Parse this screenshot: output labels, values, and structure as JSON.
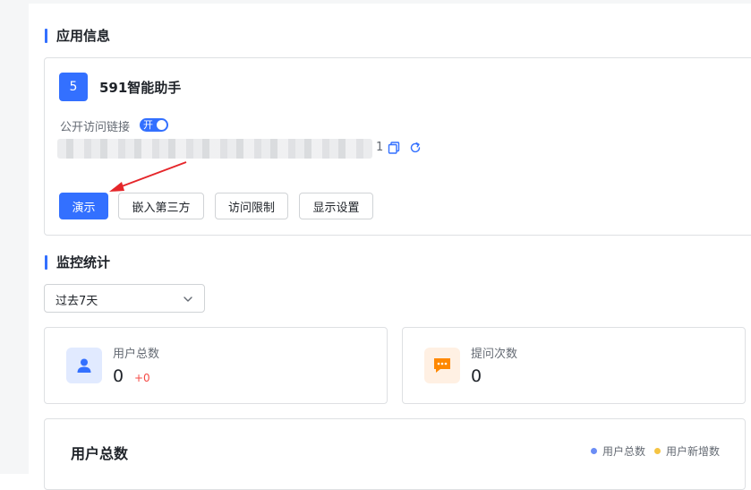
{
  "app_info": {
    "section_title": "应用信息",
    "avatar_letter": "5",
    "name": "591智能助手",
    "public_link_label": "公开访问链接",
    "switch_label": "开",
    "link_suffix": "1",
    "buttons": {
      "demo": "演示",
      "embed": "嵌入第三方",
      "access_limit": "访问限制",
      "display_settings": "显示设置"
    },
    "accent_color": "#3370ff"
  },
  "monitor": {
    "section_title": "监控统计",
    "range_select": "过去7天",
    "stats": [
      {
        "label": "用户总数",
        "value": "0",
        "delta": "+0",
        "icon": "user-icon"
      },
      {
        "label": "提问次数",
        "value": "0",
        "icon": "chat-bubble-icon"
      }
    ],
    "chart": {
      "title": "用户总数",
      "legend": [
        {
          "label": "用户总数",
          "color": "#6b8df5"
        },
        {
          "label": "用户新增数",
          "color": "#f5c443"
        }
      ]
    }
  }
}
